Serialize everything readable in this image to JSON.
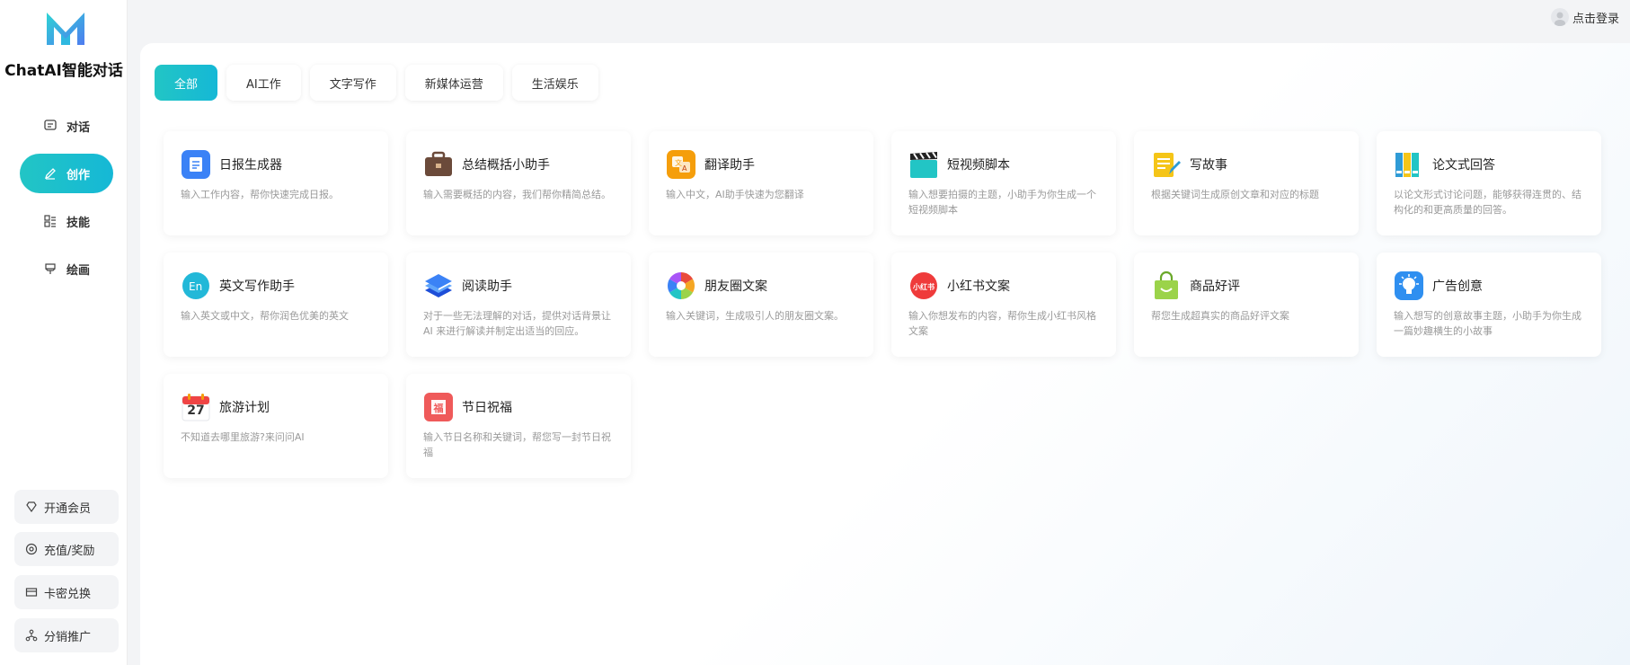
{
  "sidebar": {
    "brand": "ChatAI智能对话",
    "nav": [
      {
        "label": "对话",
        "icon": "chat-icon"
      },
      {
        "label": "创作",
        "icon": "pen-icon",
        "active": true
      },
      {
        "label": "技能",
        "icon": "grid-icon"
      },
      {
        "label": "绘画",
        "icon": "brush-icon"
      }
    ],
    "bottom": [
      {
        "label": "开通会员",
        "icon": "diamond-icon"
      },
      {
        "label": "充值/奖励",
        "icon": "coin-icon"
      },
      {
        "label": "卡密兑换",
        "icon": "card-icon"
      },
      {
        "label": "分销推广",
        "icon": "share-icon"
      }
    ]
  },
  "header": {
    "login": "点击登录"
  },
  "tabs": [
    "全部",
    "AI工作",
    "文字写作",
    "新媒体运营",
    "生活娱乐"
  ],
  "cards": [
    {
      "title": "日报生成器",
      "desc": "输入工作内容，帮你快速完成日报。",
      "icon": "report-icon",
      "color": "#3b82f6"
    },
    {
      "title": "总结概括小助手",
      "desc": "输入需要概括的内容，我们帮你精简总结。",
      "icon": "briefcase-icon",
      "color": "#6b4a3a"
    },
    {
      "title": "翻译助手",
      "desc": "输入中文，AI助手快速为您翻译",
      "icon": "translate-icon",
      "color": "#f59e0b"
    },
    {
      "title": "短视频脚本",
      "desc": "输入想要拍摄的主题，小助手为你生成一个短视频脚本",
      "icon": "clapper-icon",
      "color": "#22c5c5"
    },
    {
      "title": "写故事",
      "desc": "根据关键词生成原创文章和对应的标题",
      "icon": "notepad-icon",
      "color": "#f5c518"
    },
    {
      "title": "论文式回答",
      "desc": "以论文形式讨论问题，能够获得连贯的、结构化的和更高质量的回答。",
      "icon": "books-icon",
      "color": "#34b4e0"
    },
    {
      "title": "英文写作助手",
      "desc": "输入英文或中文，帮你润色优美的英文",
      "icon": "english-icon",
      "color": "#22b8d8"
    },
    {
      "title": "阅读助手",
      "desc": "对于一些无法理解的对话，提供对话背景让 AI 来进行解读并制定出适当的回应。",
      "icon": "book-stack-icon",
      "color": "#3b82f6"
    },
    {
      "title": "朋友圈文案",
      "desc": "输入关键词，生成吸引人的朋友圈文案。",
      "icon": "aperture-icon",
      "color": "#e94b3c"
    },
    {
      "title": "小红书文案",
      "desc": "输入你想发布的内容，帮你生成小红书风格文案",
      "icon": "xiaohongshu-icon",
      "color": "#ef3b3b"
    },
    {
      "title": "商品好评",
      "desc": "帮您生成超真实的商品好评文案",
      "icon": "shopping-bag-icon",
      "color": "#9bd34a"
    },
    {
      "title": "广告创意",
      "desc": "输入想写的创意故事主题，小助手为你生成一篇妙趣横生的小故事",
      "icon": "lightbulb-icon",
      "color": "#2f8ff0"
    },
    {
      "title": "旅游计划",
      "desc": "不知道去哪里旅游?来问问AI",
      "icon": "calendar-icon",
      "color": "#ef4444",
      "badge": "27"
    },
    {
      "title": "节日祝福",
      "desc": "输入节日名称和关键词，帮您写一封节日祝福",
      "icon": "gift-icon",
      "color": "#ef5a5a",
      "badge": "福"
    }
  ]
}
